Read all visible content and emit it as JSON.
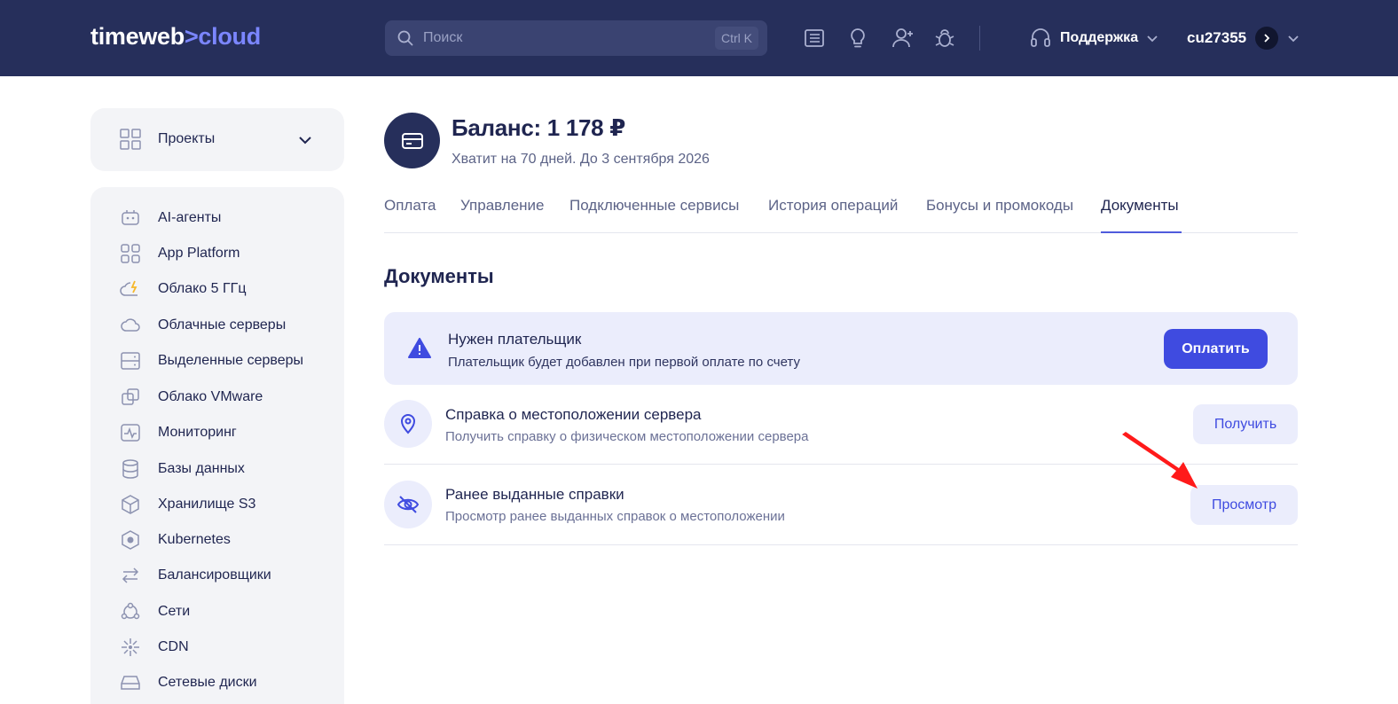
{
  "topbar": {
    "logo_main": "timeweb",
    "logo_mark": ">",
    "logo_accent": "cloud",
    "search_placeholder": "Поиск",
    "search_shortcut": "Ctrl K",
    "icons": [
      "news-icon",
      "lightbulb-icon",
      "add-user-icon",
      "bug-icon"
    ],
    "support_label": "Поддержка",
    "username": "cu27355"
  },
  "sidebar": {
    "projects_label": "Проекты",
    "items": [
      {
        "label": "AI-агенты",
        "icon": "robot-icon"
      },
      {
        "label": "App Platform",
        "icon": "grid-icon"
      },
      {
        "label": "Облако 5 ГГц",
        "icon": "cloud-bolt-icon"
      },
      {
        "label": "Облачные серверы",
        "icon": "cloud-icon"
      },
      {
        "label": "Выделенные серверы",
        "icon": "server-icon"
      },
      {
        "label": "Облако VMware",
        "icon": "vmware-icon"
      },
      {
        "label": "Мониторинг",
        "icon": "monitoring-icon"
      },
      {
        "label": "Базы данных",
        "icon": "database-icon"
      },
      {
        "label": "Хранилище S3",
        "icon": "cube-icon"
      },
      {
        "label": "Kubernetes",
        "icon": "kubernetes-icon"
      },
      {
        "label": "Балансировщики",
        "icon": "arrows-icon"
      },
      {
        "label": "Сети",
        "icon": "network-icon"
      },
      {
        "label": "CDN",
        "icon": "cdn-icon"
      },
      {
        "label": "Сетевые диски",
        "icon": "disk-icon"
      }
    ]
  },
  "balance": {
    "title": "Баланс: 1 178 ₽",
    "subtitle": "Хватит на 70 дней. До 3 сентября 2026"
  },
  "tabs": [
    {
      "label": "Оплата",
      "active": false
    },
    {
      "label": "Управление",
      "active": false
    },
    {
      "label": "Подключенные сервисы",
      "active": false
    },
    {
      "label": "История операций",
      "active": false
    },
    {
      "label": "Бонусы и промокоды",
      "active": false
    },
    {
      "label": "Документы",
      "active": true
    }
  ],
  "documents": {
    "title": "Документы",
    "alert": {
      "title": "Нужен плательщик",
      "subtitle": "Плательщик будет добавлен при первой оплате по счету",
      "button": "Оплатить"
    },
    "rows": [
      {
        "title": "Справка о местоположении сервера",
        "subtitle": "Получить справку о физическом местоположении сервера",
        "button": "Получить",
        "icon": "location-pin-icon"
      },
      {
        "title": "Ранее выданные справки",
        "subtitle": "Просмотр ранее выданных справок о местоположении",
        "button": "Просмотр",
        "icon": "eye-off-icon"
      }
    ]
  },
  "colors": {
    "header_bg": "#262f5b",
    "accent": "#3f4be0",
    "light_accent_bg": "#ebedfc",
    "annotation_arrow": "#ff1a1a"
  }
}
